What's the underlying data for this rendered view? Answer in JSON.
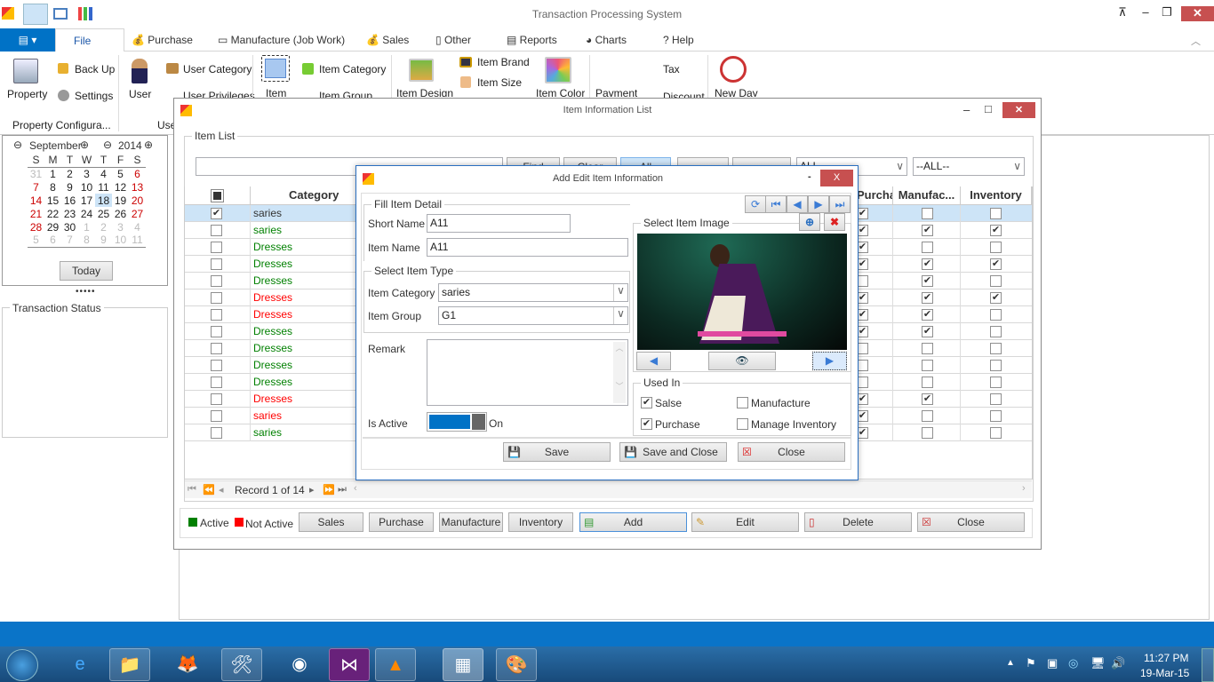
{
  "app": {
    "title": "Transaction Processing System"
  },
  "tabs": [
    {
      "label": "File"
    },
    {
      "label": "Purchase"
    },
    {
      "label": "Manufacture (Job Work)"
    },
    {
      "label": "Sales"
    },
    {
      "label": "Other"
    },
    {
      "label": "Reports"
    },
    {
      "label": "Charts"
    },
    {
      "label": "Help"
    }
  ],
  "ribbon": {
    "property": "Property",
    "backup": "Back Up",
    "settings": "Settings",
    "user": "User",
    "user_category": "User Category",
    "user_privileges": "User Privileges",
    "item": "Item",
    "item_category": "Item Category",
    "item_group": "Item Group",
    "item_design": "Item Design",
    "item_brand": "Item Brand",
    "item_size": "Item Size",
    "item_color": "Item Color",
    "payment": "Payment",
    "tax": "Tax",
    "discount": "Discount",
    "new_day": "New Day",
    "group1": "Property Configura...",
    "group2": "Use"
  },
  "calendar": {
    "month": "September",
    "year": "2014",
    "days": [
      "S",
      "M",
      "T",
      "W",
      "T",
      "F",
      "S"
    ],
    "weeks": [
      [
        "31",
        "1",
        "2",
        "3",
        "4",
        "5",
        "6"
      ],
      [
        "7",
        "8",
        "9",
        "10",
        "11",
        "12",
        "13"
      ],
      [
        "14",
        "15",
        "16",
        "17",
        "18",
        "19",
        "20"
      ],
      [
        "21",
        "22",
        "23",
        "24",
        "25",
        "26",
        "27"
      ],
      [
        "28",
        "29",
        "30",
        "1",
        "2",
        "3",
        "4"
      ],
      [
        "5",
        "6",
        "7",
        "8",
        "9",
        "10",
        "11"
      ]
    ],
    "selected": "18",
    "today_label": "Today"
  },
  "transaction_status": {
    "label": "Transaction Status"
  },
  "list_window": {
    "title": "Item Information List",
    "group": "Item List",
    "toolbar": {
      "find": "Find",
      "clear": "Clear",
      "all": "All",
      "filter1": "ALL",
      "filter2": "--ALL--"
    },
    "columns": [
      "Category Name",
      "Purchase",
      "Manufac...",
      "Inventory"
    ],
    "rows": [
      {
        "category": "saries",
        "active": true,
        "checked": true,
        "purchase": true,
        "manufacture": false,
        "inventory": false
      },
      {
        "category": "saries",
        "active": true,
        "checked": false,
        "purchase": true,
        "manufacture": true,
        "inventory": true
      },
      {
        "category": "Dresses",
        "active": true,
        "checked": false,
        "purchase": true,
        "manufacture": false,
        "inventory": false
      },
      {
        "category": "Dresses",
        "active": true,
        "checked": false,
        "purchase": true,
        "manufacture": true,
        "inventory": true
      },
      {
        "category": "Dresses",
        "active": true,
        "checked": false,
        "purchase": false,
        "manufacture": true,
        "inventory": false
      },
      {
        "category": "Dresses",
        "active": false,
        "checked": false,
        "purchase": true,
        "manufacture": true,
        "inventory": true
      },
      {
        "category": "Dresses",
        "active": false,
        "checked": false,
        "purchase": true,
        "manufacture": true,
        "inventory": false
      },
      {
        "category": "Dresses",
        "active": true,
        "checked": false,
        "purchase": true,
        "manufacture": true,
        "inventory": false
      },
      {
        "category": "Dresses",
        "active": true,
        "checked": false,
        "purchase": false,
        "manufacture": false,
        "inventory": false
      },
      {
        "category": "Dresses",
        "active": true,
        "checked": false,
        "purchase": false,
        "manufacture": false,
        "inventory": false
      },
      {
        "category": "Dresses",
        "active": true,
        "checked": false,
        "purchase": false,
        "manufacture": false,
        "inventory": false
      },
      {
        "category": "Dresses",
        "active": false,
        "checked": false,
        "purchase": true,
        "manufacture": true,
        "inventory": false
      },
      {
        "category": "saries",
        "active": false,
        "checked": false,
        "purchase": true,
        "manufacture": false,
        "inventory": false
      },
      {
        "category": "saries",
        "active": true,
        "checked": false,
        "purchase": true,
        "manufacture": false,
        "inventory": false
      }
    ],
    "pager": "Record 1 of 14",
    "legend_active": "Active",
    "legend_inactive": "Not Active",
    "buttons": {
      "sales": "Sales",
      "purchase": "Purchase",
      "manufacture": "Manufacture",
      "inventory": "Inventory",
      "add": "Add",
      "edit": "Edit",
      "delete": "Delete",
      "close": "Close"
    }
  },
  "dialog": {
    "title": "Add Edit Item Information",
    "fill_group": "Fill Item Detail",
    "short_name_label": "Short Name",
    "short_name": "A11",
    "item_name_label": "Item Name",
    "item_name": "A11",
    "type_group": "Select Item Type",
    "category_label": "Item Category",
    "category": "saries",
    "group_label": "Item Group",
    "group": "G1",
    "remark_label": "Remark",
    "remark": "",
    "is_active_label": "Is Active",
    "is_active": "On",
    "image_group": "Select Item Image",
    "used_in_group": "Used In",
    "used_in": {
      "salse": "Salse",
      "manufacture": "Manufacture",
      "purchase": "Purchase",
      "manage_inventory": "Manage Inventory"
    },
    "used_in_checked": {
      "salse": true,
      "manufacture": false,
      "purchase": true,
      "manage_inventory": false
    },
    "save": "Save",
    "save_close": "Save and Close",
    "close": "Close"
  },
  "colors": {
    "active": "#008000",
    "inactive": "#ff0000",
    "accent": "#0072c6",
    "close": "#c75050"
  },
  "taskbar": {
    "time": "11:27 PM",
    "date": "19-Mar-15"
  }
}
